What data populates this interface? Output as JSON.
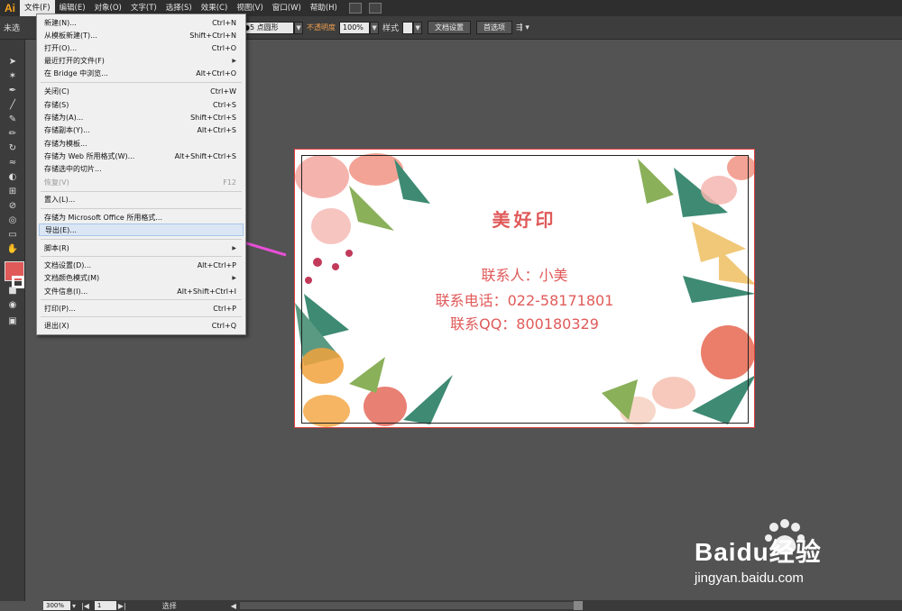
{
  "menubar": {
    "logo": "Ai",
    "items": [
      "文件(F)",
      "编辑(E)",
      "对象(O)",
      "文字(T)",
      "选择(S)",
      "效果(C)",
      "视图(V)",
      "窗口(W)",
      "帮助(H)"
    ]
  },
  "control_bar": {
    "left_label": "未选",
    "stroke_profile": "5 点圆形",
    "opacity_label": "不透明度",
    "opacity_value": "100%",
    "style_label": "样式",
    "document_setup_button": "文档设置",
    "preferences_button": "首选项"
  },
  "file_menu": {
    "items": [
      {
        "label": "新建(N)...",
        "shortcut": "Ctrl+N"
      },
      {
        "label": "从模板新建(T)...",
        "shortcut": "Shift+Ctrl+N"
      },
      {
        "label": "打开(O)...",
        "shortcut": "Ctrl+O"
      },
      {
        "label": "最近打开的文件(F)",
        "shortcut": ""
      },
      {
        "label": "在 Bridge 中浏览...",
        "shortcut": "Alt+Ctrl+O"
      },
      {
        "label": "关闭(C)",
        "shortcut": "Ctrl+W"
      },
      {
        "label": "存储(S)",
        "shortcut": "Ctrl+S"
      },
      {
        "label": "存储为(A)...",
        "shortcut": "Shift+Ctrl+S"
      },
      {
        "label": "存储副本(Y)...",
        "shortcut": "Alt+Ctrl+S"
      },
      {
        "label": "存储为模板...",
        "shortcut": ""
      },
      {
        "label": "存储为 Web 所用格式(W)...",
        "shortcut": "Alt+Shift+Ctrl+S"
      },
      {
        "label": "存储选中的切片...",
        "shortcut": ""
      },
      {
        "label": "恢复(V)",
        "shortcut": "F12"
      },
      {
        "label": "置入(L)...",
        "shortcut": ""
      },
      {
        "label": "存储为 Microsoft Office 所用格式...",
        "shortcut": ""
      },
      {
        "label": "导出(E)...",
        "shortcut": ""
      },
      {
        "label": "脚本(R)",
        "shortcut": ""
      },
      {
        "label": "文档设置(D)...",
        "shortcut": "Alt+Ctrl+P"
      },
      {
        "label": "文档颜色模式(M)",
        "shortcut": ""
      },
      {
        "label": "文件信息(I)...",
        "shortcut": "Alt+Shift+Ctrl+I"
      },
      {
        "label": "打印(P)...",
        "shortcut": "Ctrl+P"
      },
      {
        "label": "退出(X)",
        "shortcut": "Ctrl+Q"
      }
    ]
  },
  "card": {
    "title": "美好印",
    "contact": "联系人：小美",
    "phone": "联系电话：022-58171801",
    "qq": "联系QQ：800180329"
  },
  "status_bar": {
    "zoom": "300%",
    "page": "1",
    "tool": "选择"
  },
  "watermark": {
    "brand": "Baidu经验",
    "url": "jingyan.baidu.com"
  },
  "colors": {
    "card_text": "#e05a5a",
    "menu_highlight": "#dbe6f4",
    "arrow": "#e84fd6"
  }
}
